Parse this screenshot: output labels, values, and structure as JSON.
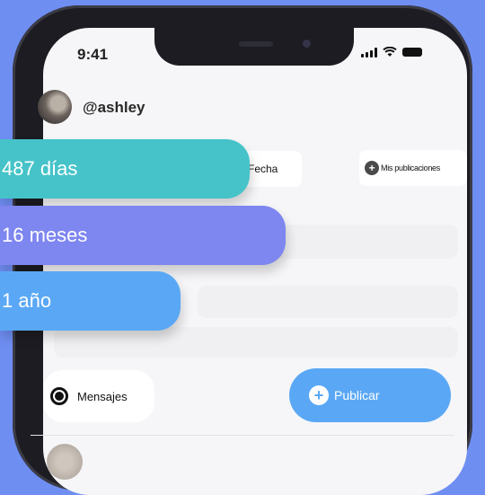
{
  "status_bar": {
    "time": "9:41"
  },
  "profile": {
    "username": "@ashley"
  },
  "filters": {
    "fecha": "Fecha",
    "mis_publicaciones": "Mis publicaciones"
  },
  "stats": [
    {
      "label": "487 días",
      "color": "#45c3c9"
    },
    {
      "label": "16 meses",
      "color": "#7e86ef"
    },
    {
      "label": "1 año",
      "color": "#5aa8f5"
    }
  ],
  "bottom": {
    "messages_label": "Mensajes",
    "publish_label": "Publicar"
  },
  "colors": {
    "background": "#6f8ef2",
    "phone_frame": "#1c1c22",
    "screen": "#f6f6f8"
  }
}
